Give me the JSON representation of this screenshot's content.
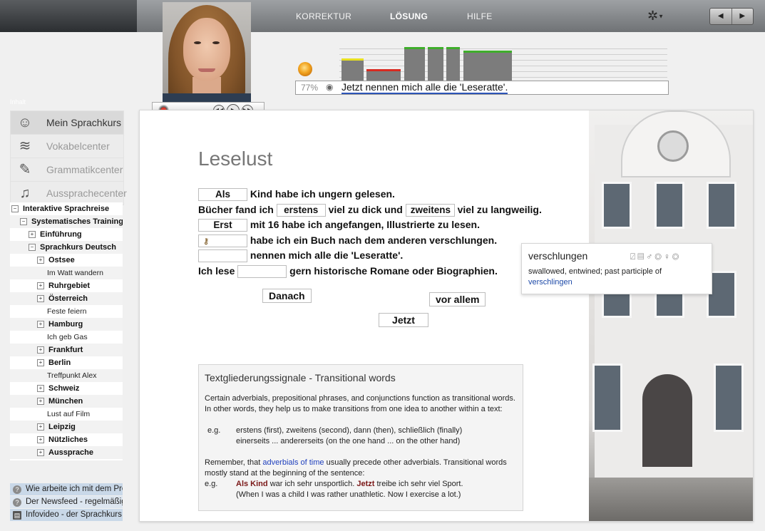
{
  "topnav": {
    "korrektur": "KORREKTUR",
    "loesung": "LÖSUNG",
    "hilfe": "HILFE",
    "prev_icon": "◀",
    "next_icon": "▶"
  },
  "audio": {
    "percent": "77%",
    "sentence": "Jetzt nennen mich alle die 'Leseratte'.",
    "bars": [
      {
        "level": 0.62,
        "cap": "#e8e020"
      },
      {
        "level": 0.33,
        "cap": "#d92a20"
      },
      {
        "level": 0.92,
        "cap": "#3fae2b"
      },
      {
        "level": 0.92,
        "cap": "#3fae2b"
      },
      {
        "level": 0.92,
        "cap": "#3fae2b"
      },
      {
        "level": 0.82,
        "cap": "#3fae2b"
      }
    ]
  },
  "sidebar": {
    "heading": "Inhalt",
    "courses": [
      {
        "label": "Mein Sprachkurs",
        "icon": "headset-icon"
      },
      {
        "label": "Vokabelcenter",
        "icon": "vocabulary-icon"
      },
      {
        "label": "Grammatikcenter",
        "icon": "notebook-icon"
      },
      {
        "label": "Aussprachecenter",
        "icon": "microphone-icon"
      }
    ],
    "tree": [
      {
        "label": "Interaktive Sprachreise",
        "indent": 0,
        "toggle": "−",
        "bold": true
      },
      {
        "label": "Systematisches Training",
        "indent": 1,
        "toggle": "−",
        "bold": true
      },
      {
        "label": "Einführung",
        "indent": 2,
        "toggle": "+",
        "bold": true
      },
      {
        "label": "Sprachkurs Deutsch",
        "indent": 2,
        "toggle": "−",
        "bold": true
      },
      {
        "label": "Ostsee",
        "indent": 3,
        "toggle": "+",
        "bold": true
      },
      {
        "label": "Im Watt wandern",
        "indent": 3,
        "toggle": "",
        "bold": false
      },
      {
        "label": "Ruhrgebiet",
        "indent": 3,
        "toggle": "+",
        "bold": true
      },
      {
        "label": "Österreich",
        "indent": 3,
        "toggle": "+",
        "bold": true
      },
      {
        "label": "Feste feiern",
        "indent": 3,
        "toggle": "",
        "bold": false
      },
      {
        "label": "Hamburg",
        "indent": 3,
        "toggle": "+",
        "bold": true
      },
      {
        "label": "Ich geb Gas",
        "indent": 3,
        "toggle": "",
        "bold": false
      },
      {
        "label": "Frankfurt",
        "indent": 3,
        "toggle": "+",
        "bold": true
      },
      {
        "label": "Berlin",
        "indent": 3,
        "toggle": "+",
        "bold": true
      },
      {
        "label": "Treffpunkt Alex",
        "indent": 3,
        "toggle": "",
        "bold": false
      },
      {
        "label": "Schweiz",
        "indent": 3,
        "toggle": "+",
        "bold": true
      },
      {
        "label": "München",
        "indent": 3,
        "toggle": "+",
        "bold": true
      },
      {
        "label": "Lust auf Film",
        "indent": 3,
        "toggle": "",
        "bold": false
      },
      {
        "label": "Leipzig",
        "indent": 3,
        "toggle": "+",
        "bold": true
      },
      {
        "label": "Nützliches",
        "indent": 3,
        "toggle": "+",
        "bold": true
      },
      {
        "label": "Aussprache",
        "indent": 3,
        "toggle": "+",
        "bold": true
      }
    ],
    "help": [
      {
        "label": "Wie arbeite ich mit dem Programm",
        "icon": "?"
      },
      {
        "label": "Der Newsfeed - regelmäßig",
        "icon": "?"
      },
      {
        "label": "Infovideo - der Sprachkurs",
        "icon": "▤"
      }
    ]
  },
  "main": {
    "title": "Leselust",
    "exercise": {
      "l1_answer": "Als",
      "l1_rest": "Kind habe ich ungern gelesen.",
      "l2_a": "Bücher fand ich",
      "l2_answer1": "erstens",
      "l2_b": "viel zu dick und",
      "l2_answer2": "zweitens",
      "l2_c": "viel zu langweilig.",
      "l3_answer": "Erst",
      "l3_rest": "mit 16 habe ich angefangen, Illustrierte zu lesen.",
      "l4_rest": "habe ich ein Buch nach dem anderen verschlungen.",
      "l5_rest": "nennen mich alle die 'Leseratte'.",
      "l6_a": "Ich lese",
      "l6_rest": "gern historische Romane oder Biographien."
    },
    "word_bank": [
      "Danach",
      "vor allem",
      "Jetzt"
    ],
    "tooltip": {
      "word": "verschlungen",
      "definition": "swallowed, entwined; past participle of",
      "link": "verschlingen"
    },
    "info": {
      "heading": "Textgliederungssignale - Transitional words",
      "p1": "Certain adverbials, prepositional phrases, and conjunctions function as transitional words. In other words, they help us to make transitions from one idea to another within a text:",
      "eg": "e.g.",
      "eg1_line1": "erstens (first), zweitens (second), dann (then), schließlich (finally)",
      "eg1_line2": "einerseits ... andererseits (on the one hand ... on the other hand)",
      "p2_a": "Remember, that",
      "p2_link": "adverbials of time",
      "p2_b": "usually precede other adverbials. Transitional words mostly stand at the beginning of the sentence:",
      "eg2_w1": "Als Kind",
      "eg2_t1": "war ich sehr unsportlich.",
      "eg2_w2": "Jetzt",
      "eg2_t2": "treibe ich sehr viel Sport.",
      "eg2_line2": "(When I was a child I was rather unathletic. Now I exercise a lot.)"
    }
  }
}
